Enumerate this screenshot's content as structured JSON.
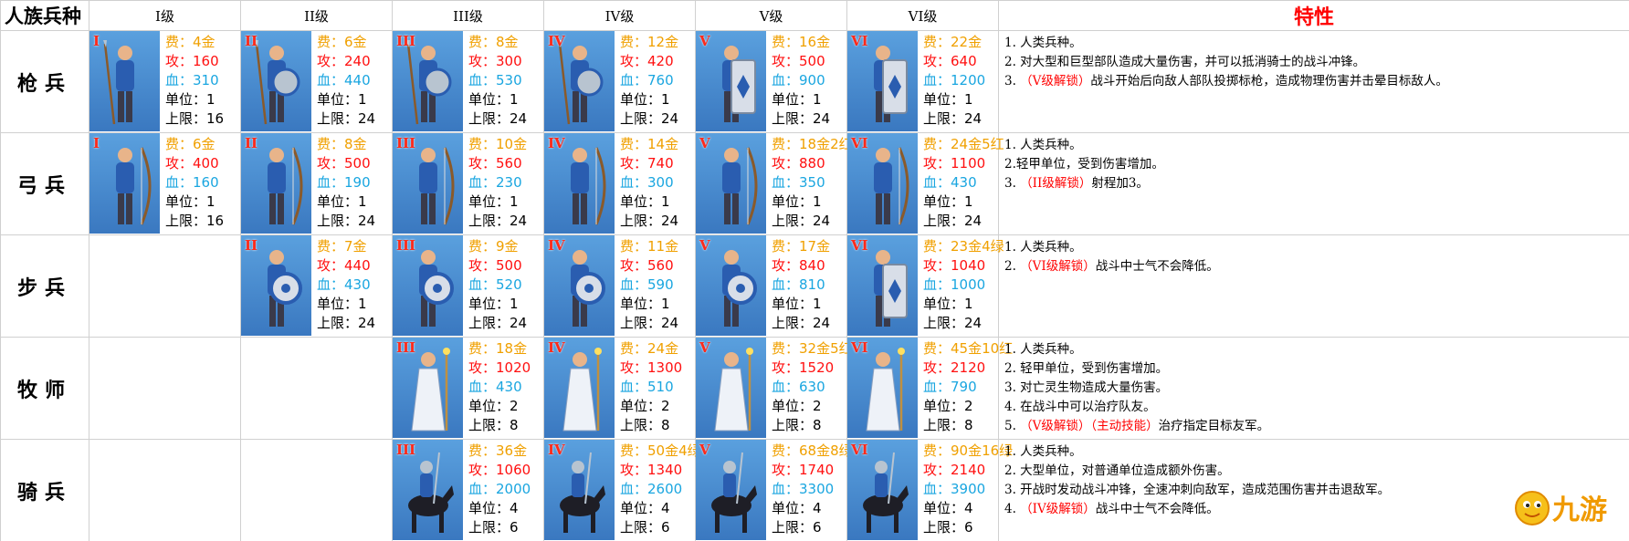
{
  "header": {
    "corner": "人族兵种",
    "tiers": [
      "I级",
      "II级",
      "III级",
      "IV级",
      "V级",
      "VI级"
    ],
    "features": "特性"
  },
  "rows": [
    {
      "name": "枪兵",
      "units": [
        {
          "tier": "I",
          "cost": "费：4金",
          "atk": "攻：160",
          "hp": "血：310",
          "unit": "单位：1",
          "cap": "上限：16",
          "weapon": "spear"
        },
        {
          "tier": "II",
          "cost": "费：6金",
          "atk": "攻：240",
          "hp": "血：440",
          "unit": "单位：1",
          "cap": "上限：24",
          "weapon": "spear-shield"
        },
        {
          "tier": "III",
          "cost": "费：8金",
          "atk": "攻：300",
          "hp": "血：530",
          "unit": "单位：1",
          "cap": "上限：24",
          "weapon": "spear-shield"
        },
        {
          "tier": "IV",
          "cost": "费：12金",
          "atk": "攻：420",
          "hp": "血：760",
          "unit": "单位：1",
          "cap": "上限：24",
          "weapon": "spear-shield"
        },
        {
          "tier": "V",
          "cost": "费：16金",
          "atk": "攻：500",
          "hp": "血：900",
          "unit": "单位：1",
          "cap": "上限：24",
          "weapon": "tower-shield"
        },
        {
          "tier": "VI",
          "cost": "费：22金",
          "atk": "攻：640",
          "hp": "血：1200",
          "unit": "单位：1",
          "cap": "上限：24",
          "weapon": "tower-shield"
        }
      ],
      "desc": [
        {
          "pre": "1. 人类兵种。",
          "red": "",
          "post": ""
        },
        {
          "pre": "2. 对大型和巨型部队造成大量伤害，并可以抵消骑士的战斗冲锋。",
          "red": "",
          "post": ""
        },
        {
          "pre": "3. ",
          "red": "（V级解锁）",
          "post": "战斗开始后向敌人部队投掷标枪，造成物理伤害并击晕目标敌人。"
        }
      ]
    },
    {
      "name": "弓兵",
      "units": [
        {
          "tier": "I",
          "cost": "费：6金",
          "atk": "攻：400",
          "hp": "血：160",
          "unit": "单位：1",
          "cap": "上限：16",
          "weapon": "bow"
        },
        {
          "tier": "II",
          "cost": "费：8金",
          "atk": "攻：500",
          "hp": "血：190",
          "unit": "单位：1",
          "cap": "上限：24",
          "weapon": "bow"
        },
        {
          "tier": "III",
          "cost": "费：10金",
          "atk": "攻：560",
          "hp": "血：230",
          "unit": "单位：1",
          "cap": "上限：24",
          "weapon": "bow"
        },
        {
          "tier": "IV",
          "cost": "费：14金",
          "atk": "攻：740",
          "hp": "血：300",
          "unit": "单位：1",
          "cap": "上限：24",
          "weapon": "bow"
        },
        {
          "tier": "V",
          "cost": "费：18金2红",
          "atk": "攻：880",
          "hp": "血：350",
          "unit": "单位：1",
          "cap": "上限：24",
          "weapon": "bow"
        },
        {
          "tier": "VI",
          "cost": "费：24金5红",
          "atk": "攻：1100",
          "hp": "血：430",
          "unit": "单位：1",
          "cap": "上限：24",
          "weapon": "bow"
        }
      ],
      "desc": [
        {
          "pre": "1. 人类兵种。",
          "red": "",
          "post": ""
        },
        {
          "pre": "2.轻甲单位，受到伤害增加。",
          "red": "",
          "post": ""
        },
        {
          "pre": "3. ",
          "red": "（II级解锁）",
          "post": "射程加3。"
        }
      ]
    },
    {
      "name": "步兵",
      "units": [
        null,
        {
          "tier": "II",
          "cost": "费：7金",
          "atk": "攻：440",
          "hp": "血：430",
          "unit": "单位：1",
          "cap": "上限：24",
          "weapon": "shield"
        },
        {
          "tier": "III",
          "cost": "费：9金",
          "atk": "攻：500",
          "hp": "血：520",
          "unit": "单位：1",
          "cap": "上限：24",
          "weapon": "shield"
        },
        {
          "tier": "IV",
          "cost": "费：11金",
          "atk": "攻：560",
          "hp": "血：590",
          "unit": "单位：1",
          "cap": "上限：24",
          "weapon": "shield"
        },
        {
          "tier": "V",
          "cost": "费：17金",
          "atk": "攻：840",
          "hp": "血：810",
          "unit": "单位：1",
          "cap": "上限：24",
          "weapon": "shield"
        },
        {
          "tier": "VI",
          "cost": "费：23金4绿",
          "atk": "攻：1040",
          "hp": "血：1000",
          "unit": "单位：1",
          "cap": "上限：24",
          "weapon": "tower-shield"
        }
      ],
      "desc": [
        {
          "pre": "1. 人类兵种。",
          "red": "",
          "post": ""
        },
        {
          "pre": "2. ",
          "red": "（VI级解锁）",
          "post": "战斗中士气不会降低。"
        }
      ]
    },
    {
      "name": "牧师",
      "units": [
        null,
        null,
        {
          "tier": "III",
          "cost": "费：18金",
          "atk": "攻：1020",
          "hp": "血：430",
          "unit": "单位：2",
          "cap": "上限：8",
          "weapon": "staff"
        },
        {
          "tier": "IV",
          "cost": "费：24金",
          "atk": "攻：1300",
          "hp": "血：510",
          "unit": "单位：2",
          "cap": "上限：8",
          "weapon": "staff"
        },
        {
          "tier": "V",
          "cost": "费：32金5红",
          "atk": "攻：1520",
          "hp": "血：630",
          "unit": "单位：2",
          "cap": "上限：8",
          "weapon": "staff"
        },
        {
          "tier": "VI",
          "cost": "费：45金10红",
          "atk": "攻：2120",
          "hp": "血：790",
          "unit": "单位：2",
          "cap": "上限：8",
          "weapon": "staff"
        }
      ],
      "desc": [
        {
          "pre": "1. 人类兵种。",
          "red": "",
          "post": ""
        },
        {
          "pre": "2. 轻甲单位，受到伤害增加。",
          "red": "",
          "post": ""
        },
        {
          "pre": "3. 对亡灵生物造成大量伤害。",
          "red": "",
          "post": ""
        },
        {
          "pre": "4. 在战斗中可以治疗队友。",
          "red": "",
          "post": ""
        },
        {
          "pre": "5. ",
          "red": "（V级解锁）（主动技能）",
          "post": "治疗指定目标友军。"
        }
      ]
    },
    {
      "name": "骑兵",
      "units": [
        null,
        null,
        {
          "tier": "III",
          "cost": "费：36金",
          "atk": "攻：1060",
          "hp": "血：2000",
          "unit": "单位：4",
          "cap": "上限：6",
          "weapon": "horse"
        },
        {
          "tier": "IV",
          "cost": "费：50金4绿",
          "atk": "攻：1340",
          "hp": "血：2600",
          "unit": "单位：4",
          "cap": "上限：6",
          "weapon": "horse"
        },
        {
          "tier": "V",
          "cost": "费：68金8绿",
          "atk": "攻：1740",
          "hp": "血：3300",
          "unit": "单位：4",
          "cap": "上限：6",
          "weapon": "horse"
        },
        {
          "tier": "VI",
          "cost": "费：90金16绿",
          "atk": "攻：2140",
          "hp": "血：3900",
          "unit": "单位：4",
          "cap": "上限：6",
          "weapon": "horse"
        }
      ],
      "desc": [
        {
          "pre": "1. 人类兵种。",
          "red": "",
          "post": ""
        },
        {
          "pre": "2. 大型单位，对普通单位造成额外伤害。",
          "red": "",
          "post": ""
        },
        {
          "pre": "3. 开战时发动战斗冲锋，全速冲刺向敌军，造成范围伤害并击退敌军。",
          "red": "",
          "post": ""
        },
        {
          "pre": "4. ",
          "red": "（IV级解锁）",
          "post": "战斗中士气不会降低。"
        }
      ]
    }
  ],
  "watermark": {
    "text": "九游"
  },
  "colors": {
    "cost": "#f0a000",
    "attack": "#ff1010",
    "hp": "#1aa6e0",
    "tier_numeral": "#ff2a1a",
    "feature_header": "#ff0000",
    "portrait_bg": "#4a8ed4"
  }
}
